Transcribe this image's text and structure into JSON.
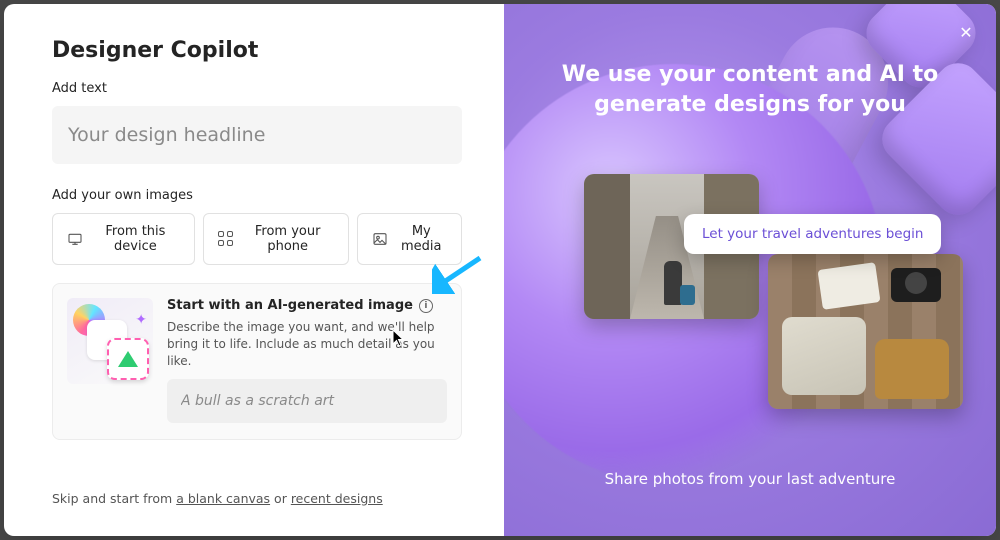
{
  "left": {
    "title": "Designer Copilot",
    "addText": {
      "label": "Add text",
      "placeholder": "Your design headline"
    },
    "addImages": {
      "label": "Add your own images",
      "sources": [
        {
          "icon": "device-icon",
          "label": "From this device"
        },
        {
          "icon": "qr-icon",
          "label": "From your phone"
        },
        {
          "icon": "media-icon",
          "label": "My media"
        }
      ]
    },
    "ai": {
      "title": "Start with an AI-generated image",
      "desc": "Describe the image you want, and we'll help bring it to life. Include as much detail as you like.",
      "placeholder": "A bull as a scratch art"
    },
    "skip": {
      "prefix": "Skip and start from ",
      "link1": "a blank canvas",
      "middle": " or ",
      "link2": "recent designs"
    }
  },
  "right": {
    "close": "✕",
    "heroLine1": "We use your content and AI to",
    "heroLine2": "generate designs for you",
    "pill": "Let your travel adventures begin",
    "caption": "Share photos from your last adventure"
  },
  "colors": {
    "accent": "#6b4fd6",
    "arrow": "#17b7ff"
  }
}
